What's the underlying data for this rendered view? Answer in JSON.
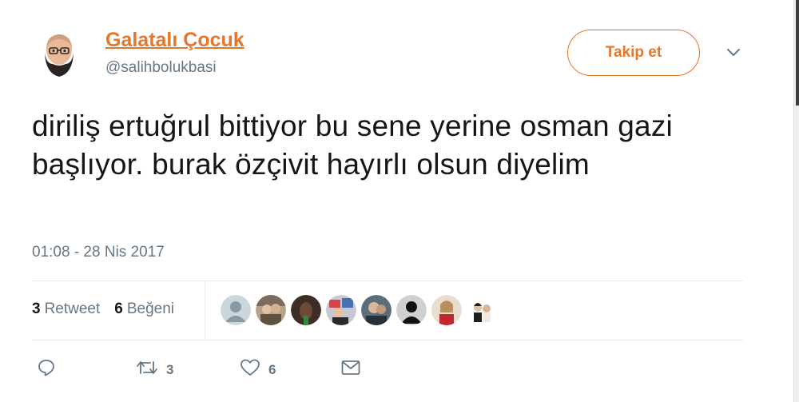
{
  "tweet": {
    "author": {
      "display_name": "Galatalı Çocuk",
      "handle": "@salihbolukbasi"
    },
    "follow_label": "Takip et",
    "text": "diriliş ertuğrul bittiyor bu sene yerine osman gazi başlıyor. burak özçivit hayırlı olsun diyelim",
    "timestamp": "01:08 - 28 Nis 2017",
    "stats": {
      "retweets_count": "3",
      "retweets_label": "Retweet",
      "likes_count": "6",
      "likes_label": "Beğeni"
    },
    "actions": {
      "retweet_count": "3",
      "like_count": "6"
    }
  },
  "colors": {
    "accent": "#e5772c",
    "text": "#14171a",
    "muted": "#657786",
    "divider": "#e6ecf0"
  },
  "icons": [
    "avatar",
    "caret-down-icon",
    "reply-icon",
    "retweet-icon",
    "heart-icon",
    "message-icon"
  ]
}
